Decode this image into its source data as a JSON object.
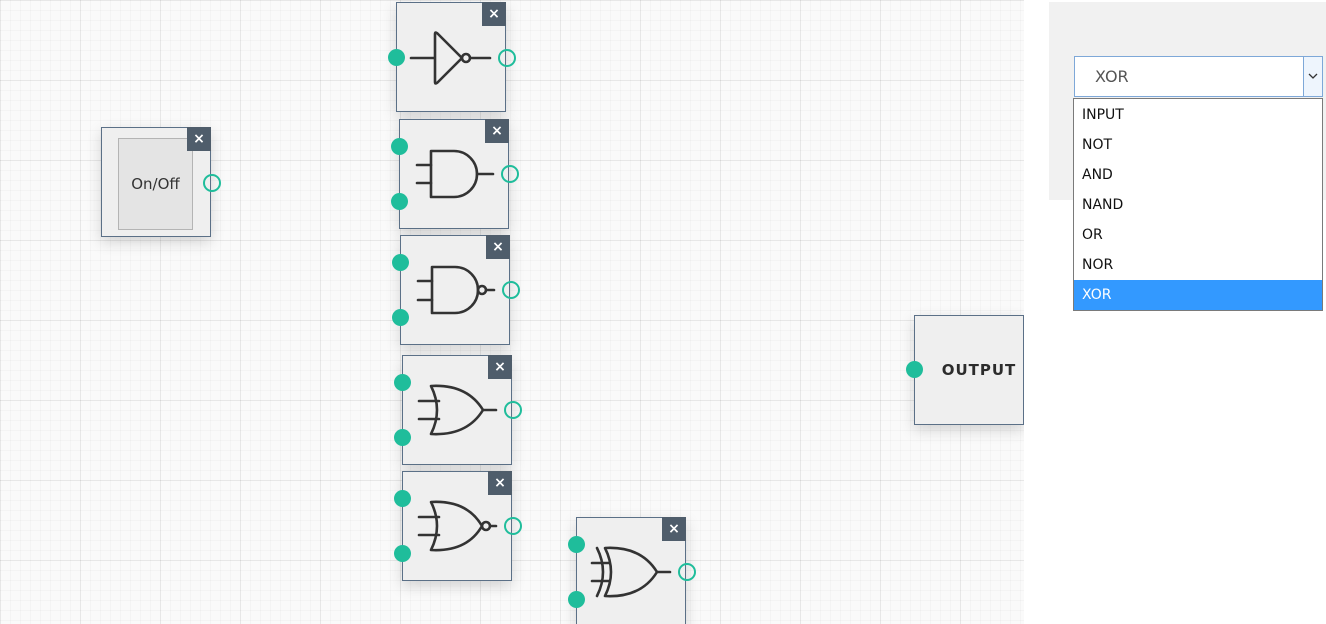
{
  "canvas": {
    "input_node": {
      "toggle_label": "On/Off",
      "close_label": "×"
    },
    "gates": [
      {
        "type": "NOT",
        "close_label": "×"
      },
      {
        "type": "AND",
        "close_label": "×"
      },
      {
        "type": "NAND",
        "close_label": "×"
      },
      {
        "type": "OR",
        "close_label": "×"
      },
      {
        "type": "NOR",
        "close_label": "×"
      },
      {
        "type": "XOR",
        "close_label": "×"
      }
    ],
    "output_node": {
      "label": "OUTPUT"
    }
  },
  "sidebar": {
    "gate_select": {
      "value": "XOR",
      "options": [
        "INPUT",
        "NOT",
        "AND",
        "NAND",
        "OR",
        "NOR",
        "XOR"
      ],
      "highlighted": "XOR"
    }
  },
  "colors": {
    "pin": "#1fbd9b",
    "node_border": "#5b7087",
    "close_button": "#4f5d6b",
    "selected_option": "#3399ff"
  }
}
